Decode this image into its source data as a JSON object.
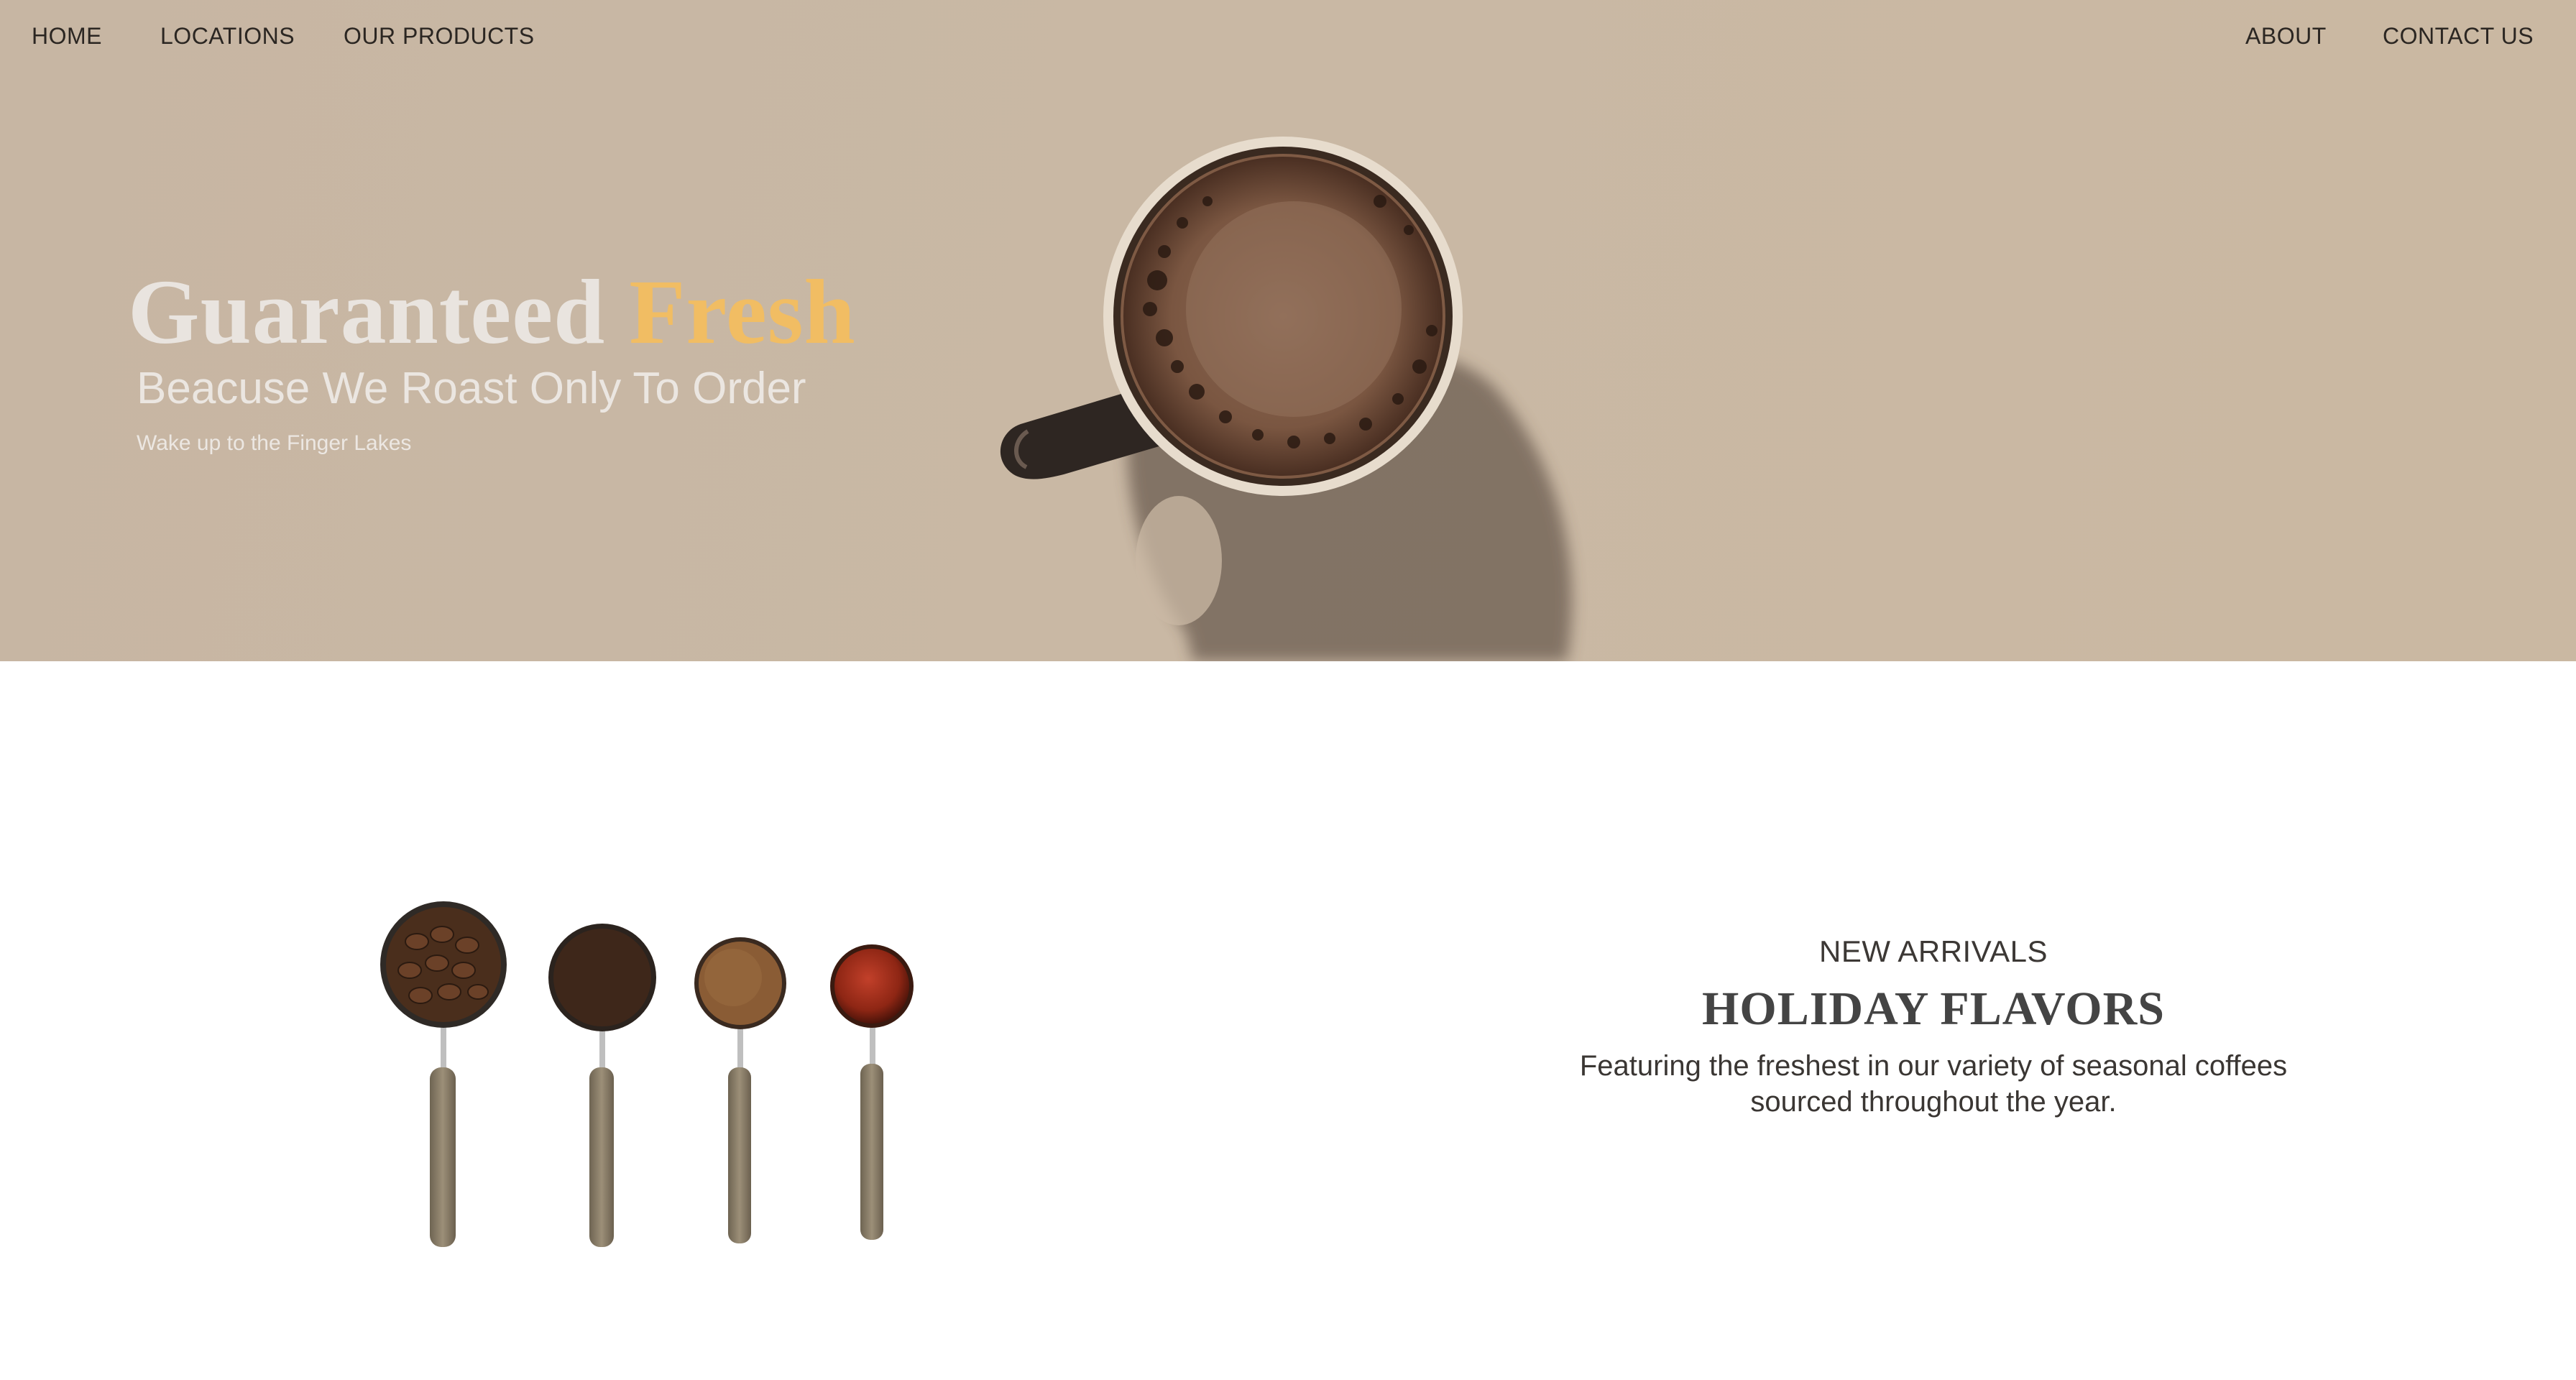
{
  "nav": {
    "left": [
      "HOME",
      "LOCATIONS",
      "OUR PRODUCTS"
    ],
    "right": [
      "ABOUT",
      "CONTACT US"
    ]
  },
  "hero": {
    "headline_part1": "Guaranteed",
    "headline_part2": "Fresh",
    "subheadline": "Beacuse We Roast Only To Order",
    "tagline": "Wake up to the Finger Lakes",
    "image": "coffee-mug-image"
  },
  "feature": {
    "eyebrow": "NEW ARRIVALS",
    "title": "HOLIDAY FLAVORS",
    "description_line1": "Featuring the freshest in our variety of seasonal coffees",
    "description_line2": "sourced throughout the year.",
    "image": "coffee-scoops-image"
  },
  "colors": {
    "hero_bg": "#c9b8a4",
    "accent": "#f1bd63",
    "nav_text": "#2b2622",
    "body_text": "#3c3835"
  }
}
